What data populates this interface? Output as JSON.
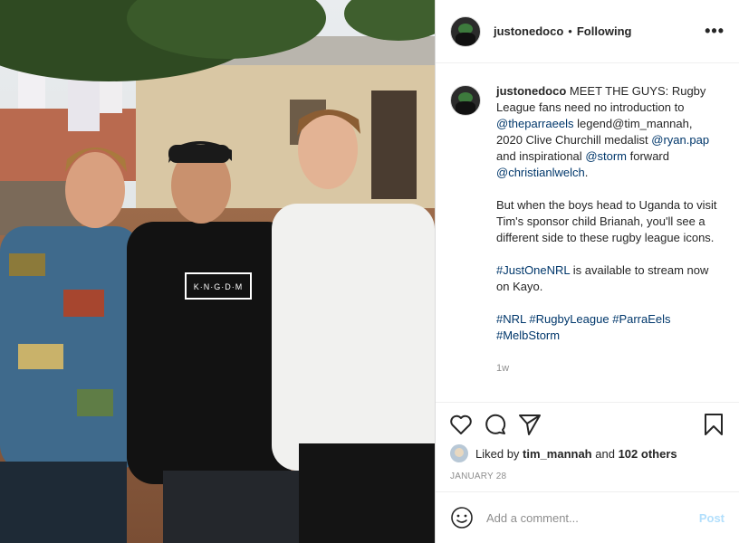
{
  "header": {
    "username": "justonedoco",
    "separator": "•",
    "follow_status": "Following",
    "more_label": "•••"
  },
  "caption": {
    "username": "justonedoco",
    "line1_text": "MEET THE GUYS: Rugby League fans need no introduction to",
    "mention1": "@theparraeels",
    "line2_text": "legend@tim_mannah, 2020 Clive Churchill medalist",
    "mention2": "@ryan.pap",
    "and_inspirational": "and inspirational",
    "mention3": "@storm",
    "forward": "forward",
    "mention4": "@christianlwelch",
    "period": ".",
    "para2": "But when the boys head to Uganda to visit Tim's sponsor child Brianah, you'll see a different side to these rugby league icons.",
    "hashtag_justonenrl": "#JustOneNRL",
    "para3_rest": "is available to stream now on Kayo.",
    "tags": [
      "#NRL",
      "#RugbyLeague",
      "#ParraEels",
      "#MelbStorm"
    ],
    "age": "1w"
  },
  "actions": {
    "icons": [
      "heart-icon",
      "comment-icon",
      "share-icon",
      "bookmark-icon"
    ],
    "liked_by_prefix": "Liked by",
    "liked_by_user": "tim_mannah",
    "and": "and",
    "others": "102 others",
    "date": "JANUARY 28"
  },
  "comment_box": {
    "placeholder": "Add a comment...",
    "post_label": "Post"
  },
  "photo": {
    "shirt_text": "K·N·G·D·M"
  },
  "colors": {
    "link": "#00376b",
    "muted": "#8e8e8e",
    "post_disabled": "#b2dffc"
  }
}
